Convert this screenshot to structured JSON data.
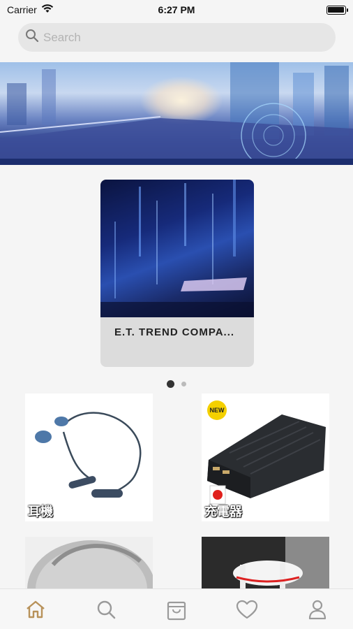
{
  "status_bar": {
    "carrier": "Carrier",
    "time": "6:27 PM"
  },
  "search": {
    "placeholder": "Search",
    "value": ""
  },
  "featured": {
    "title": "E.T. TREND COMPA..."
  },
  "pager": {
    "page_count": 2,
    "current_page": 1
  },
  "products": [
    {
      "label": "耳機",
      "badge": ""
    },
    {
      "label": "充電器",
      "badge": "NEW"
    },
    {
      "label": "",
      "badge": ""
    },
    {
      "label": "",
      "badge": ""
    }
  ],
  "tab_bar": {
    "active_tab": "home",
    "accent_color": "#b8925a",
    "inactive_color": "#9a9a9a",
    "tabs": [
      "home-icon",
      "search-icon",
      "shopping-bag-icon",
      "heart-icon",
      "user-icon"
    ]
  }
}
